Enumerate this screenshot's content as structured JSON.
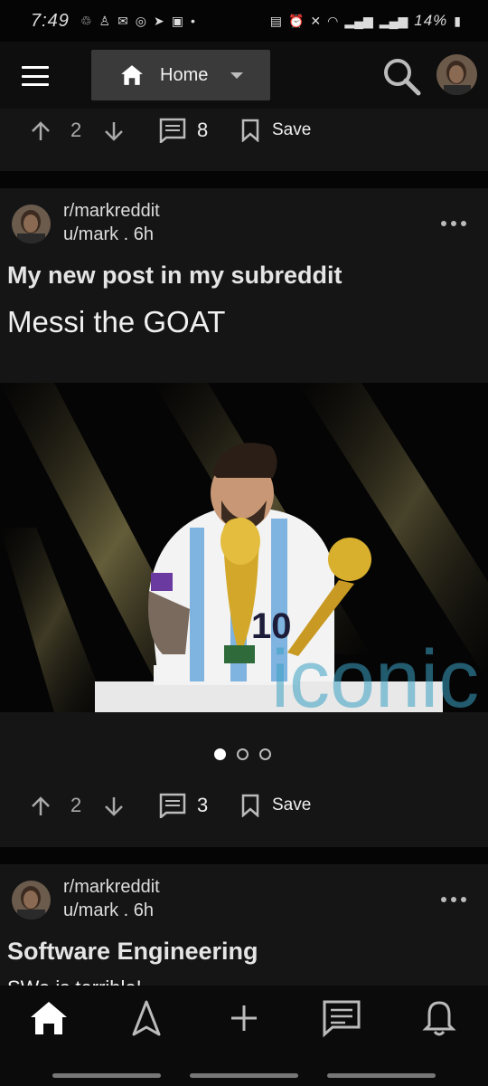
{
  "status_bar": {
    "time": "7:49",
    "battery": "14%"
  },
  "header": {
    "feed_selector": "Home"
  },
  "posts": [
    {
      "upvotes": "2",
      "comments": "8",
      "save_label": "Save"
    },
    {
      "subreddit": "r/markreddit",
      "user_time": "u/mark . 6h",
      "title": "My new post in my subreddit",
      "body": "Messi the GOAT",
      "image_watermark": "iconic",
      "image_pages": 3,
      "image_page_active": 1,
      "upvotes": "2",
      "comments": "3",
      "save_label": "Save"
    },
    {
      "subreddit": "r/markreddit",
      "user_time": "u/mark . 6h",
      "title": "Software Engineering",
      "body": "SWe is terrible!"
    }
  ],
  "bottom_nav": [
    {
      "name": "home-icon"
    },
    {
      "name": "explore-icon"
    },
    {
      "name": "add-icon"
    },
    {
      "name": "chat-icon"
    },
    {
      "name": "notifications-icon"
    }
  ],
  "colors": {
    "background": "#050505",
    "card": "#151515",
    "selector": "#3a3a3a",
    "text": "#e8e8e8"
  }
}
